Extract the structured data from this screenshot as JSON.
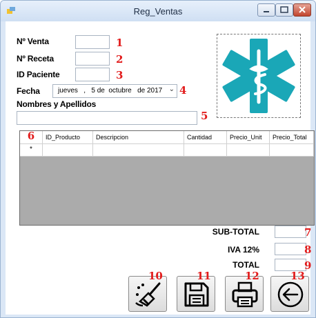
{
  "window": {
    "title": "Reg_Ventas"
  },
  "form": {
    "venta_label": "Nº Venta",
    "receta_label": "Nº Receta",
    "paciente_label": "ID Paciente",
    "fecha_label": "Fecha",
    "fecha_value": "jueves   ,   5 de  octubre   de 2017",
    "nombres_label": "Nombres y Apellidos",
    "venta_value": "",
    "receta_value": "",
    "paciente_value": "",
    "nombres_value": ""
  },
  "markers": [
    "1",
    "2",
    "3",
    "4",
    "5",
    "6",
    "7",
    "8",
    "9",
    "10",
    "11",
    "12",
    "13"
  ],
  "grid": {
    "columns": [
      "ID_Producto",
      "Descripcion",
      "Cantidad",
      "Precio_Unit",
      "Precio_Total"
    ],
    "new_row_marker": "*"
  },
  "totals": {
    "subtotal_label": "SUB-TOTAL",
    "iva_label": "IVA 12%",
    "total_label": "TOTAL",
    "subtotal_value": "",
    "iva_value": "",
    "total_value": ""
  },
  "icons": {
    "logo": "star-of-life-icon",
    "clear": "broom-icon",
    "save": "floppy-disk-icon",
    "print": "printer-icon",
    "back": "back-arrow-icon"
  },
  "colors": {
    "logo": "#1aa7b7",
    "marker": "#e21c1c",
    "grid_background": "#ababab"
  }
}
